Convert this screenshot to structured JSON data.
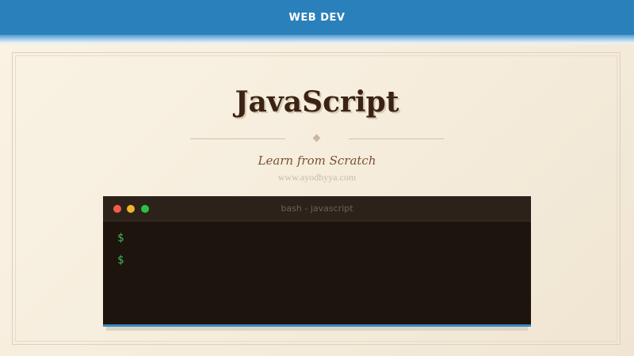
{
  "header": {
    "label": "WEB DEV"
  },
  "hero": {
    "title": "JavaScript",
    "subtitle": "Learn from Scratch",
    "website": "www.ayodhyya.com"
  },
  "terminal": {
    "title": "bash - javascript",
    "window_controls": [
      "close",
      "minimize",
      "maximize"
    ],
    "lines": [
      {
        "prompt": "$",
        "text": ""
      },
      {
        "prompt": "$",
        "text": ""
      }
    ]
  },
  "colors": {
    "header_bg": "#2a80bb",
    "page_bg": "#f7efde",
    "title": "#3b2314",
    "subtitle": "#7a5232",
    "terminal_bg": "#1d140d",
    "terminal_accent": "#3a87c5",
    "prompt": "#3fbd5a",
    "dot_close": "#f45a4b",
    "dot_minimize": "#f2b427",
    "dot_maximize": "#2dc046"
  }
}
